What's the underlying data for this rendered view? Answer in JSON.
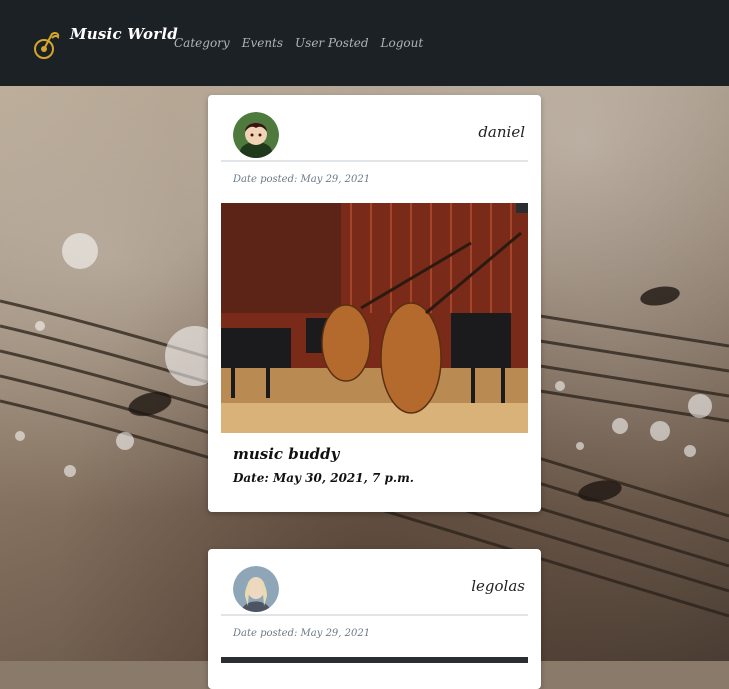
{
  "brand": {
    "name": "Music World",
    "logo_icon": "music-note-logo-icon"
  },
  "nav": {
    "items": [
      {
        "label": "Category"
      },
      {
        "label": "Events"
      },
      {
        "label": "User Posted"
      },
      {
        "label": "Logout"
      }
    ]
  },
  "posts": [
    {
      "author": "daniel",
      "date_posted": "Date posted: May 29, 2021",
      "image": "orchestra-instruments-image",
      "title": "music buddy",
      "event_date": "Date: May 30, 2021, 7 p.m."
    },
    {
      "author": "legolas",
      "date_posted": "Date posted: May 29, 2021"
    }
  ],
  "colors": {
    "navbar": "#1c2126",
    "nav_link": "#aeb4ba",
    "card": "#ffffff",
    "date_text": "#6c7a86"
  }
}
